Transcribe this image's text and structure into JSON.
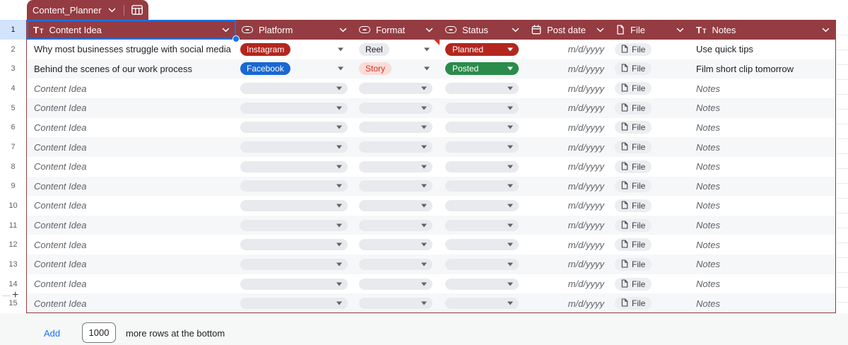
{
  "tab": {
    "title": "Content_Planner"
  },
  "header": {
    "columns": [
      {
        "id": "content_idea",
        "icon": "text-column-icon",
        "label": "Content Idea"
      },
      {
        "id": "platform",
        "icon": "dropdown-column-icon",
        "label": "Platform"
      },
      {
        "id": "format",
        "icon": "dropdown-column-icon",
        "label": "Format"
      },
      {
        "id": "status",
        "icon": "dropdown-column-icon",
        "label": "Status"
      },
      {
        "id": "post_date",
        "icon": "calendar-icon",
        "label": "Post date"
      },
      {
        "id": "file",
        "icon": "file-icon",
        "label": "File"
      },
      {
        "id": "notes",
        "icon": "text-column-icon",
        "label": "Notes"
      }
    ]
  },
  "selection": {
    "row_number": "1",
    "selected_header": "Content Idea"
  },
  "placeholders": {
    "idea": "Content Idea",
    "date": "m/d/yyyy",
    "file": "File",
    "notes": "Notes"
  },
  "rows": [
    {
      "num": "2",
      "idea": "Why most businesses struggle with social media",
      "platform": {
        "label": "Instagram",
        "bg": "#b3261e",
        "fg": "#ffffff"
      },
      "format": {
        "label": "Reel",
        "bg": "#e9eaed",
        "fg": "#202124"
      },
      "status": {
        "label": "Planned",
        "bg": "#b3261e"
      },
      "date": "m/d/yyyy",
      "file": "File",
      "notes": "Use quick tips",
      "comment": true
    },
    {
      "num": "3",
      "idea": "Behind the scenes of our work process",
      "platform": {
        "label": "Facebook",
        "bg": "#1967d2",
        "fg": "#ffffff"
      },
      "format": {
        "label": "Story",
        "bg": "#fadcd9",
        "fg": "#d93025"
      },
      "status": {
        "label": "Posted",
        "bg": "#2a8c4a"
      },
      "date": "m/d/yyyy",
      "file": "File",
      "notes": "Film short clip tomorrow"
    },
    {
      "num": "4",
      "placeholder": true
    },
    {
      "num": "5",
      "placeholder": true
    },
    {
      "num": "6",
      "placeholder": true
    },
    {
      "num": "7",
      "placeholder": true
    },
    {
      "num": "8",
      "placeholder": true
    },
    {
      "num": "9",
      "placeholder": true
    },
    {
      "num": "10",
      "placeholder": true
    },
    {
      "num": "11",
      "placeholder": true
    },
    {
      "num": "12",
      "placeholder": true
    },
    {
      "num": "13",
      "placeholder": true
    },
    {
      "num": "14",
      "placeholder": true
    },
    {
      "num": "15",
      "placeholder": true
    }
  ],
  "footer": {
    "add_label": "Add",
    "rows_count": "1000",
    "suffix": "more rows at the bottom"
  },
  "colors": {
    "table_theme": "#943c42",
    "selection_blue": "#1a73e8",
    "row_alt": "#f5f7f8",
    "chip_instagram": "#b3261e",
    "chip_facebook": "#1967d2",
    "chip_reel_bg": "#e9eaed",
    "chip_story_bg": "#fadcd9",
    "chip_story_fg": "#d93025",
    "status_planned": "#b3261e",
    "status_posted": "#2a8c4a",
    "comment_marker": "#d93025",
    "placeholder_pill": "#e8eaed",
    "add_link": "#1a73e8"
  }
}
